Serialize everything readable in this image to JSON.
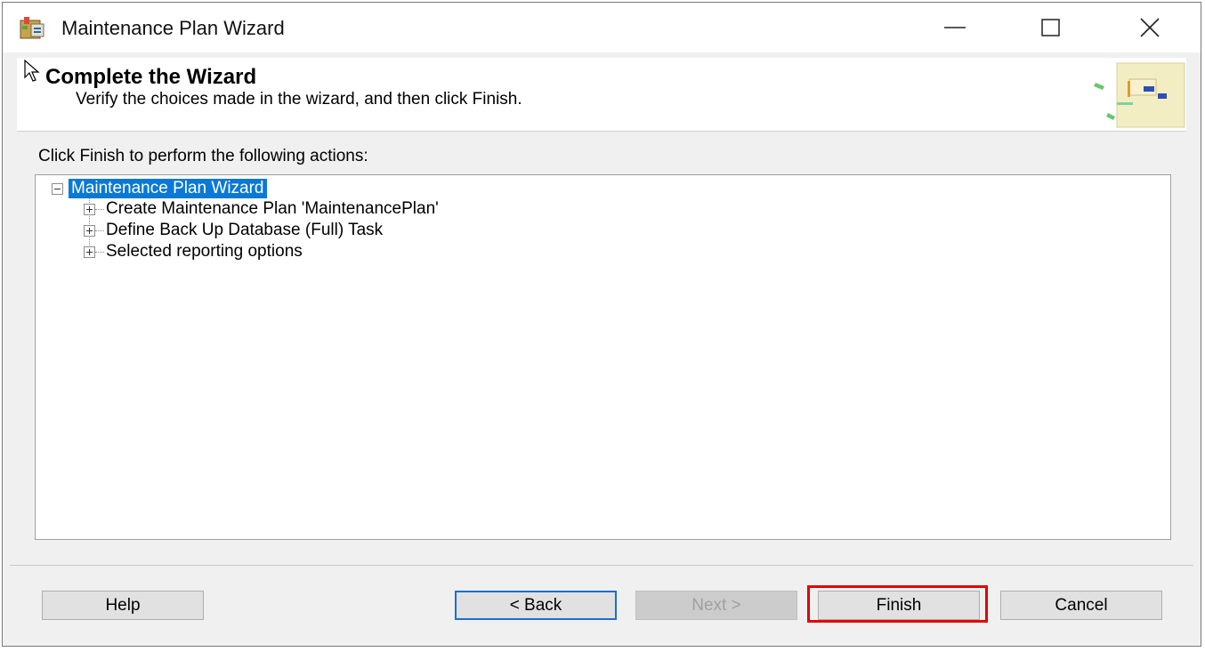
{
  "window": {
    "title": "Maintenance Plan Wizard",
    "controls": [
      "minimize",
      "maximize",
      "close"
    ]
  },
  "header": {
    "title": "Complete the Wizard",
    "subtitle": "Verify the choices made in the wizard, and then click Finish."
  },
  "body": {
    "instructions": "Click Finish to perform the following actions:",
    "tree": {
      "root": {
        "label": "Maintenance Plan Wizard",
        "expanded": true,
        "selected": true
      },
      "children": [
        {
          "label": "Create Maintenance Plan 'MaintenancePlan'",
          "expanded": false
        },
        {
          "label": "Define Back Up Database (Full) Task",
          "expanded": false
        },
        {
          "label": "Selected reporting options",
          "expanded": false
        }
      ]
    }
  },
  "footer": {
    "help": "Help",
    "back": "< Back",
    "next": "Next >",
    "finish": "Finish",
    "cancel": "Cancel"
  },
  "colors": {
    "selection": "#0a78d7",
    "highlight_box": "#e50000",
    "focus_border": "#1a6fd1"
  },
  "icons": [
    "app-icon",
    "minimize-icon",
    "maximize-icon",
    "close-icon",
    "cursor-icon",
    "wizard-header-art",
    "expand-icon",
    "collapse-icon"
  ]
}
